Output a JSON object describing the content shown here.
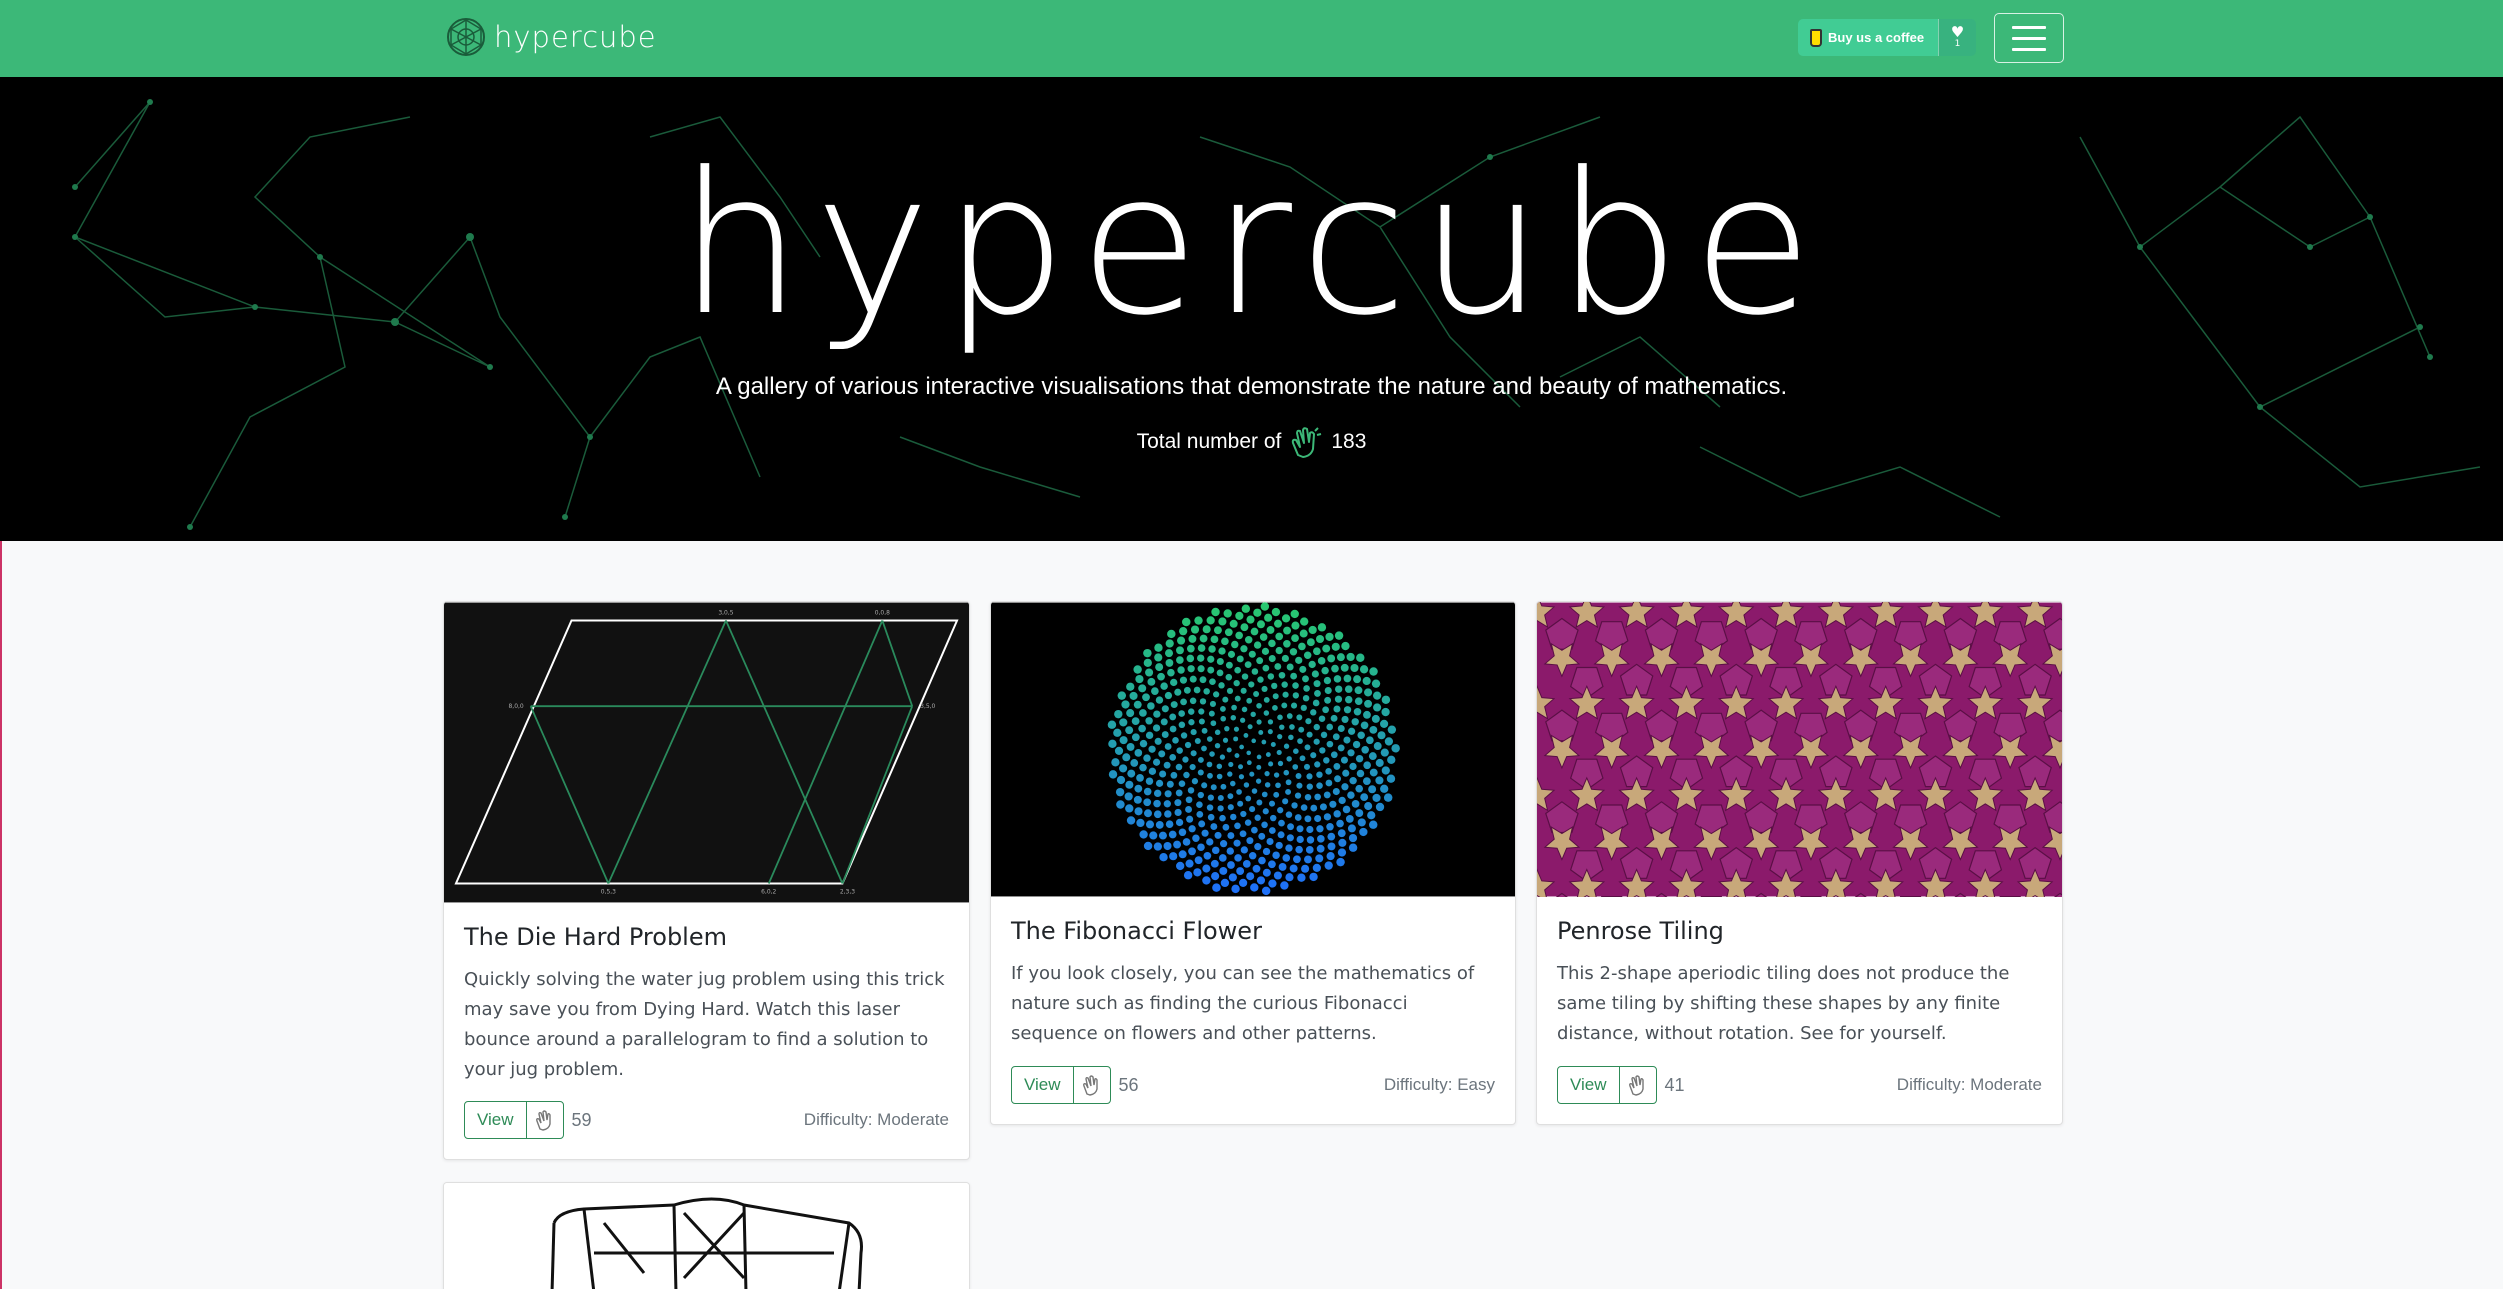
{
  "navbar": {
    "brand": "hypercube",
    "coffee_label": "Buy us a coffee",
    "coffee_heart_count": "1",
    "menu_icon": "hamburger-icon"
  },
  "hero": {
    "title": "hypercube",
    "subtitle": "A gallery of various interactive visualisations that demonstrate the nature and beauty of mathematics.",
    "count_label": "Total number of",
    "count_icon": "clap-icon",
    "count_value": "183"
  },
  "cards": [
    {
      "title": "The Die Hard Problem",
      "text": "Quickly solving the water jug problem using this trick may save you from Dying Hard. Watch this laser bounce around a parallelogram to find a solution to your jug problem.",
      "view_label": "View",
      "claps": "59",
      "difficulty": "Difficulty: Moderate"
    },
    {
      "title": "The Fibonacci Flower",
      "text": "If you look closely, you can see the mathematics of nature such as finding the curious Fibonacci sequence on flowers and other patterns.",
      "view_label": "View",
      "claps": "56",
      "difficulty": "Difficulty: Easy"
    },
    {
      "title": "Penrose Tiling",
      "text": "This 2-shape aperiodic tiling does not produce the same tiling by shifting these shapes by any finite distance, without rotation. See for yourself.",
      "view_label": "View",
      "claps": "41",
      "difficulty": "Difficulty: Moderate"
    }
  ],
  "colors": {
    "navbar": "#3cb878",
    "accent": "#2e8b57",
    "penrose_purple": "#8b1a6b",
    "penrose_tan": "#c8a87a"
  }
}
